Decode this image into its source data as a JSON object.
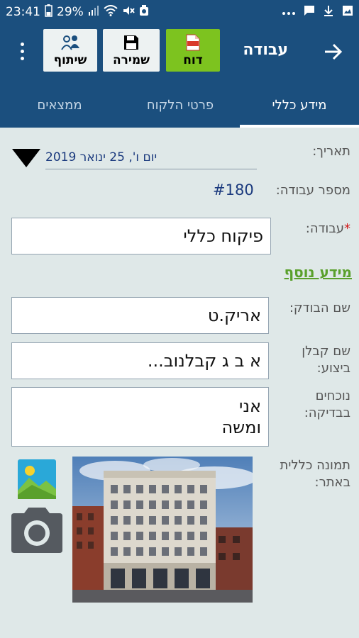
{
  "status_bar": {
    "time": "23:41",
    "battery": "29%",
    "icons": [
      "battery-icon",
      "signal-icon",
      "wifi-icon",
      "mute-icon",
      "alarm-icon",
      "more-dots-icon",
      "message-icon",
      "download-icon",
      "image-icon"
    ]
  },
  "app_bar": {
    "title": "עבודה",
    "report_label": "דוח",
    "save_label": "שמירה",
    "share_label": "שיתוף",
    "accent_report": "#7dc31f",
    "bar_color": "#1b4f7e"
  },
  "tabs": [
    {
      "label": "מידע כללי",
      "active": true
    },
    {
      "label": "פרטי הלקוח",
      "active": false
    },
    {
      "label": "ממצאים",
      "active": false
    }
  ],
  "form": {
    "date_label": "תאריך:",
    "date_value": "יום ו', 25 ינואר 2019",
    "job_number_label": "מספר עבודה:",
    "job_number_value": "#180",
    "required_mark": "*",
    "job_label": "עבודה:",
    "job_value": "פיקוח כללי",
    "more_info_link": "מידע נוסף",
    "inspector_label": "שם הבודק:",
    "inspector_value": "אריק.ט",
    "contractor_label_line1": "שם קבלן",
    "contractor_label_line2": "ביצוע:",
    "contractor_value": "א ב ג קבלנוב...",
    "present_label_line1": "נוכחים",
    "present_label_line2": "בבדיקה:",
    "present_value_line1": "אני",
    "present_value_line2": "ומשה",
    "photo_label_line1": "תמונה כללית",
    "photo_label_line2": "באתר:"
  }
}
